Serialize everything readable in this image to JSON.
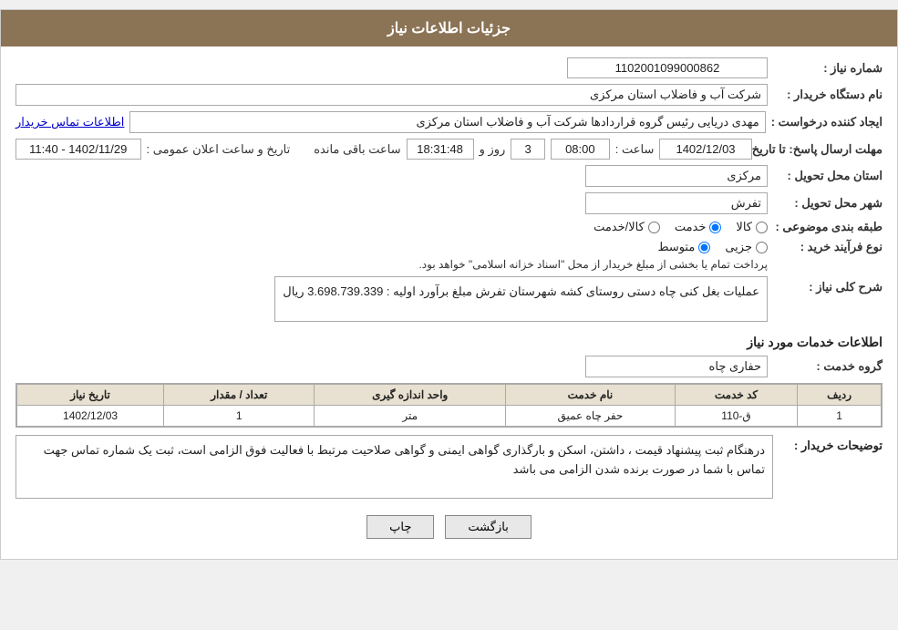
{
  "header": {
    "title": "جزئیات اطلاعات نیاز"
  },
  "fields": {
    "shomareNiaz_label": "شماره نیاز :",
    "shomareNiaz_value": "1102001099000862",
    "namdastgah_label": "نام دستگاه خریدار :",
    "namdastgah_value": "شرکت آب و فاضلاب استان مرکزی",
    "eijadKonande_label": "ایجاد کننده درخواست :",
    "eijadKonande_value": "مهدی دریایی رئیس گروه قراردادها شرکت آب و فاضلاب استان مرکزی",
    "eijadKonande_link": "اطلاعات تماس خریدار",
    "mohlat_label": "مهلت ارسال پاسخ: تا تاریخ :",
    "tarikh_value": "1402/12/03",
    "saat_label": "ساعت :",
    "saat_value": "08:00",
    "roz_label": "روز و",
    "roz_value": "3",
    "baghimande_label": "ساعت باقی مانده",
    "baghimande_time": "18:31:48",
    "tarikh_elan_label": "تاریخ و ساعت اعلان عمومی :",
    "tarikh_elan_value": "1402/11/29 - 11:40",
    "ostan_label": "استان محل تحویل :",
    "ostan_value": "مرکزی",
    "shahr_label": "شهر محل تحویل :",
    "shahr_value": "تفرش",
    "tabaqe_label": "طبقه بندی موضوعی :",
    "tabaqe_kala": "کالا",
    "tabaqe_khadamat": "خدمت",
    "tabaqe_kala_khadamat": "کالا/خدمت",
    "noeFarayand_label": "نوع فرآیند خرید :",
    "noeFarayand_jozei": "جزیی",
    "noeFarayand_motevaset": "متوسط",
    "noeFarayand_note": "پرداخت تمام یا بخشی از مبلغ خریدار از محل \"اسناد خزانه اسلامی\" خواهد بود.",
    "sharh_label": "شرح کلی نیاز :",
    "sharh_value": "عملیات بغل کنی چاه دستی روستای کشه شهرستان تفرش مبلغ برآورد اولیه : 3.698.739.339 ریال",
    "khadamat_label": "اطلاعات خدمات مورد نیاز",
    "goroh_label": "گروه خدمت :",
    "goroh_value": "حفاری چاه",
    "table": {
      "headers": [
        "ردیف",
        "کد خدمت",
        "نام خدمت",
        "واحد اندازه گیری",
        "تعداد / مقدار",
        "تاریخ نیاز"
      ],
      "rows": [
        {
          "radif": "1",
          "kod": "ق-110",
          "nam": "حفر چاه عمیق",
          "vahed": "متر",
          "tedad": "1",
          "tarikh": "1402/12/03"
        }
      ]
    },
    "tozihat_label": "توضیحات خریدار :",
    "tozihat_value": "درهنگام ثبت پیشنهاد قیمت ، داشتن، اسکن و بارگذاری گواهی ایمنی و گواهی صلاحیت مرتبط با فعالیت فوق الزامی است، ثبت یک شماره تماس جهت تماس با شما در صورت برنده شدن الزامی می باشد"
  },
  "buttons": {
    "print_label": "چاپ",
    "back_label": "بازگشت"
  }
}
